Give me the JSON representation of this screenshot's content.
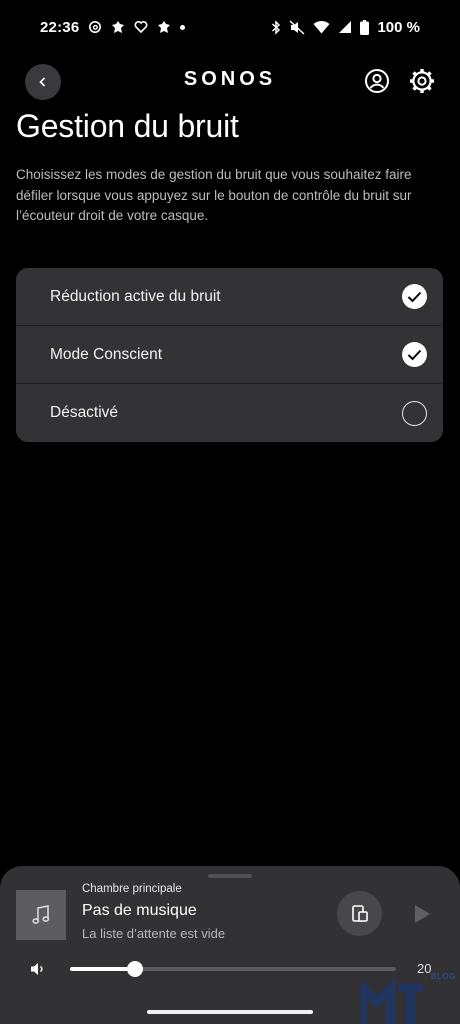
{
  "status_bar": {
    "time": "22:36",
    "notification_icons": [
      "threads-icon",
      "app-icon",
      "heart-icon",
      "app-icon"
    ],
    "battery": "100 %"
  },
  "header": {
    "brand": "SONOS",
    "back_icon": "chevron-left-icon",
    "account_icon": "account-icon",
    "settings_icon": "gear-icon"
  },
  "page": {
    "title": "Gestion du bruit",
    "description": "Choisissez les modes de gestion du bruit que vous souhaitez faire défiler lorsque vous appuyez sur le bouton de contrôle du bruit sur l’écouteur droit de votre casque."
  },
  "options": [
    {
      "label": "Réduction active du bruit",
      "checked": true
    },
    {
      "label": "Mode Conscient",
      "checked": true
    },
    {
      "label": "Désactivé",
      "checked": false
    }
  ],
  "player": {
    "room": "Chambre principale",
    "title": "Pas de musique",
    "subtitle": "La liste d’attente est vide",
    "volume": 20,
    "volume_level": 0.2
  },
  "watermark": {
    "text": "BLOG"
  }
}
